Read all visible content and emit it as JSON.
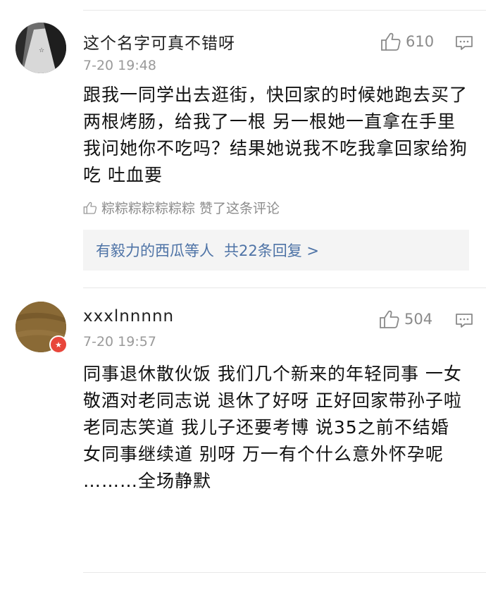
{
  "comments": [
    {
      "username": "这个名字可真不错呀",
      "time": "7-20 19:48",
      "likes": "610",
      "text": "跟我一同学出去逛街，快回家的时候她跑去买了两根烤肠，给我了一根 另一根她一直拿在手里我问她你不吃吗？结果她说我不吃我拿回家给狗吃 吐血要",
      "liked_by": "粽粽粽粽粽粽粽 赞了这条评论",
      "reply_names": "有毅力的西瓜等人",
      "reply_count": "共22条回复 >"
    },
    {
      "username": "xxxlnnnnn",
      "time": "7-20 19:57",
      "likes": "504",
      "text": "同事退休散伙饭 我们几个新来的年轻同事 一女敬酒对老同志说 退休了好呀 正好回家带孙子啦 老同志笑道 我儿子还要考博 说35之前不结婚 女同事继续道 别呀 万一有个什么意外怀孕呢 ………全场静默"
    }
  ],
  "colors": {
    "link": "#4e73a6",
    "meta": "#9a9a9a",
    "badge": "#e8463b"
  }
}
